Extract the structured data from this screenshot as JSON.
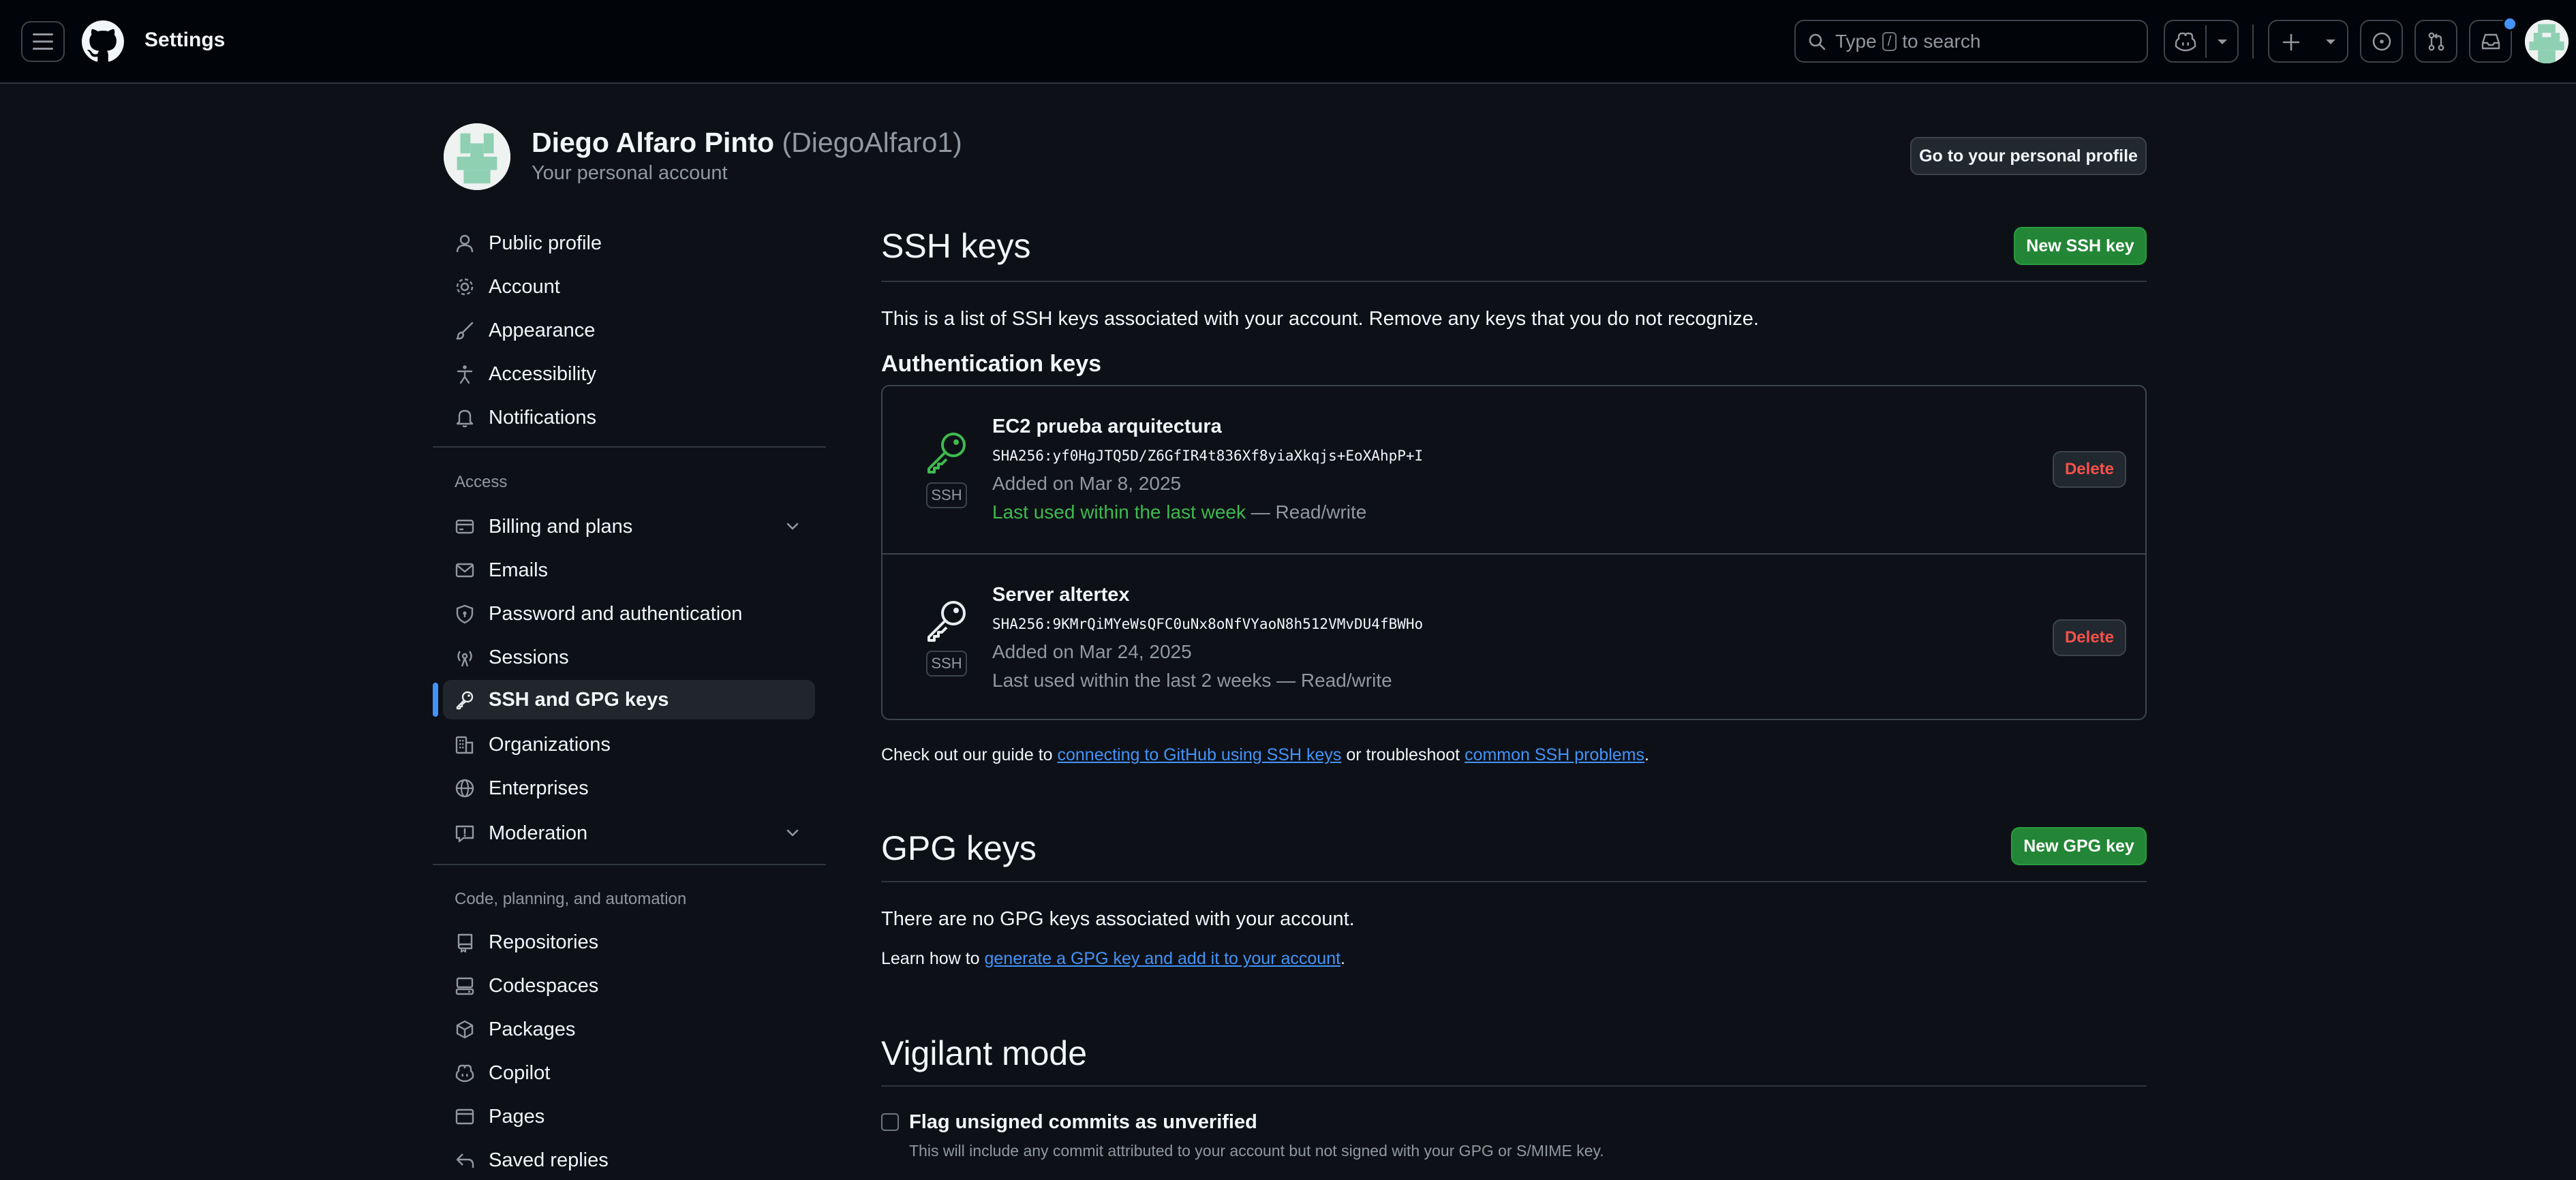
{
  "header": {
    "title": "Settings",
    "search_placeholder_before": "Type",
    "search_key": "/",
    "search_placeholder_after": "to search"
  },
  "profile": {
    "name": "Diego Alfaro Pinto",
    "login": "(DiegoAlfaro1)",
    "subtitle": "Your personal account",
    "go_profile_label": "Go to your personal profile"
  },
  "sidebar": {
    "items_top": [
      {
        "label": "Public profile",
        "icon": "person-icon"
      },
      {
        "label": "Account",
        "icon": "gear-icon"
      },
      {
        "label": "Appearance",
        "icon": "paintbrush-icon"
      },
      {
        "label": "Accessibility",
        "icon": "accessibility-icon"
      },
      {
        "label": "Notifications",
        "icon": "bell-icon"
      }
    ],
    "access_heading": "Access",
    "items_access": [
      {
        "label": "Billing and plans",
        "icon": "credit-card-icon"
      },
      {
        "label": "Emails",
        "icon": "mail-icon"
      },
      {
        "label": "Password and authentication",
        "icon": "shield-lock-icon"
      },
      {
        "label": "Sessions",
        "icon": "broadcast-icon"
      },
      {
        "label": "SSH and GPG keys",
        "icon": "key-icon"
      },
      {
        "label": "Organizations",
        "icon": "organization-icon"
      },
      {
        "label": "Enterprises",
        "icon": "globe-icon"
      },
      {
        "label": "Moderation",
        "icon": "report-icon"
      }
    ],
    "code_heading": "Code, planning, and automation",
    "items_code": [
      {
        "label": "Repositories",
        "icon": "repo-icon"
      },
      {
        "label": "Codespaces",
        "icon": "codespaces-icon"
      },
      {
        "label": "Packages",
        "icon": "package-icon"
      },
      {
        "label": "Copilot",
        "icon": "copilot-icon"
      },
      {
        "label": "Pages",
        "icon": "browser-icon"
      },
      {
        "label": "Saved replies",
        "icon": "reply-icon"
      }
    ]
  },
  "ssh": {
    "title": "SSH keys",
    "new_button": "New SSH key",
    "description": "This is a list of SSH keys associated with your account. Remove any keys that you do not recognize.",
    "auth_heading": "Authentication keys",
    "badge": "SSH",
    "delete_label": "Delete",
    "keys": [
      {
        "title": "EC2 prueba arquitectura",
        "fingerprint": "SHA256:yf0HgJTQ5D/Z6GfIR4t836Xf8yiaXkqjs+EoXAhpP+I",
        "added": "Added on Mar 8, 2025",
        "last_used": "Last used within the last week",
        "access": " — Read/write"
      },
      {
        "title": "Server altertex",
        "fingerprint": "SHA256:9KMrQiMYeWsQFC0uNx8oNfVYaoN8h512VMvDU4fBWHo",
        "added": "Added on Mar 24, 2025",
        "last_used": "Last used within the last 2 weeks",
        "access": " — Read/write"
      }
    ],
    "guide_prefix": "Check out our guide to ",
    "guide_link": "connecting to GitHub using SSH keys",
    "guide_middle": " or troubleshoot ",
    "guide_link2": "common SSH problems",
    "guide_suffix": "."
  },
  "gpg": {
    "title": "GPG keys",
    "new_button": "New GPG key",
    "empty_text": "There are no GPG keys associated with your account.",
    "learn_prefix": "Learn how to ",
    "learn_link": "generate a GPG key and add it to your account",
    "learn_suffix": "."
  },
  "vigilant": {
    "title": "Vigilant mode",
    "checkbox_label": "Flag unsigned commits as unverified",
    "checkbox_note": "This will include any commit attributed to your account but not signed with your GPG or S/MIME key."
  }
}
